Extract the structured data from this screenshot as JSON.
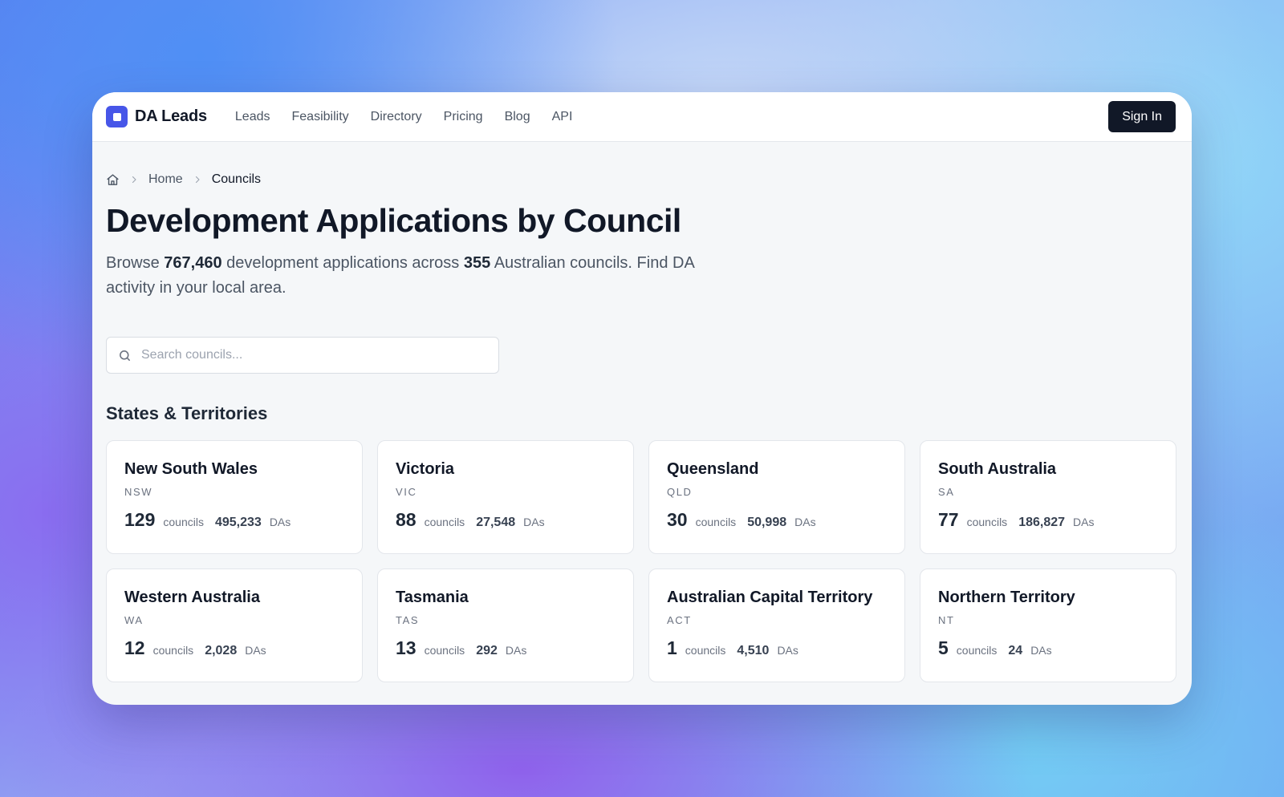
{
  "app": {
    "name": "DA Leads",
    "nav": [
      "Leads",
      "Feasibility",
      "Directory",
      "Pricing",
      "Blog",
      "API"
    ],
    "signin_label": "Sign In"
  },
  "breadcrumb": {
    "home": "Home",
    "current": "Councils"
  },
  "page": {
    "title": "Development Applications by Council",
    "subtitle": {
      "browse": "Browse",
      "total_das": "767,460",
      "across": "development applications across",
      "total_councils": "355",
      "rest": "Australian councils. Find DA activity in your local area."
    }
  },
  "search": {
    "placeholder": "Search councils...",
    "value": ""
  },
  "states_section": {
    "title": "States & Territories",
    "councils_unit": "councils",
    "das_unit": "DAs",
    "items": [
      {
        "name": "New South Wales",
        "abbr": "NSW",
        "councils": "129",
        "das": "495,233"
      },
      {
        "name": "Victoria",
        "abbr": "VIC",
        "councils": "88",
        "das": "27,548"
      },
      {
        "name": "Queensland",
        "abbr": "QLD",
        "councils": "30",
        "das": "50,998"
      },
      {
        "name": "South Australia",
        "abbr": "SA",
        "councils": "77",
        "das": "186,827"
      },
      {
        "name": "Western Australia",
        "abbr": "WA",
        "councils": "12",
        "das": "2,028"
      },
      {
        "name": "Tasmania",
        "abbr": "TAS",
        "councils": "13",
        "das": "292"
      },
      {
        "name": "Australian Capital Territory",
        "abbr": "ACT",
        "councils": "1",
        "das": "4,510"
      },
      {
        "name": "Northern Territory",
        "abbr": "NT",
        "councils": "5",
        "das": "24"
      }
    ]
  },
  "colors": {
    "brand": "#4756e8",
    "dark_button": "#111827",
    "page_bg": "#f5f7f9"
  }
}
